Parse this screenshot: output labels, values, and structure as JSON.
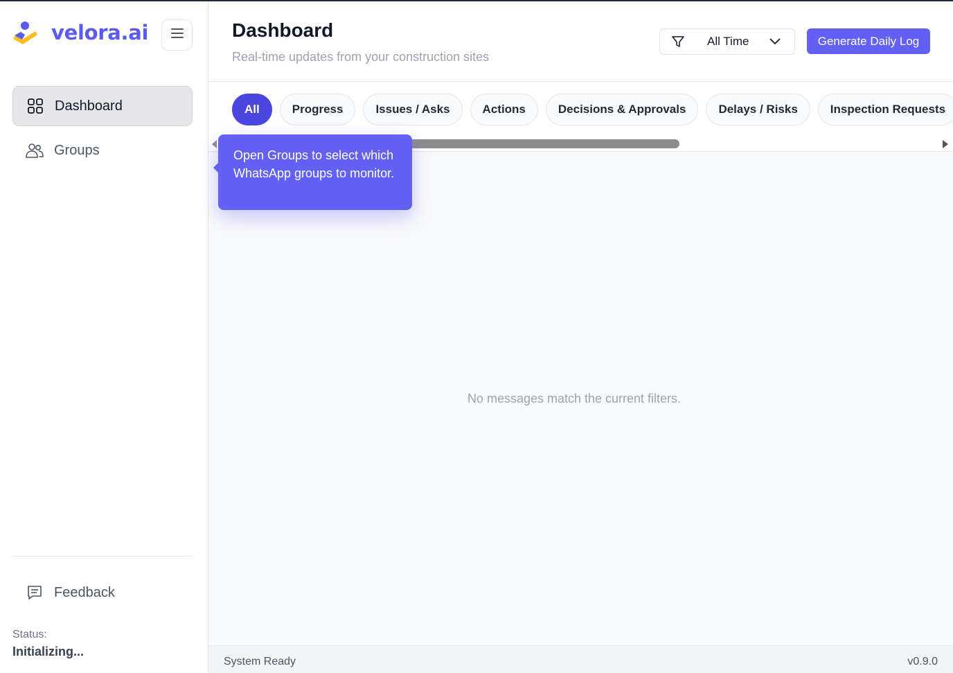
{
  "brand": {
    "name": "velora.ai",
    "logo_icon": "velora-logo-icon"
  },
  "sidebar": {
    "menu_icon": "hamburger-menu-icon",
    "items": [
      {
        "label": "Dashboard",
        "icon": "grid-icon",
        "active": true
      },
      {
        "label": "Groups",
        "icon": "users-icon",
        "active": false
      }
    ],
    "feedback": {
      "label": "Feedback",
      "icon": "message-square-icon"
    },
    "status": {
      "label": "Status:",
      "value": "Initializing..."
    }
  },
  "header": {
    "title": "Dashboard",
    "subtitle": "Real-time updates from your construction sites",
    "time_filter": {
      "icon": "funnel-icon",
      "selected": "All Time",
      "chevron": "chevron-down-icon"
    },
    "primary_button": "Generate Daily Log"
  },
  "tabs": [
    {
      "label": "All",
      "active": true
    },
    {
      "label": "Progress",
      "active": false
    },
    {
      "label": "Issues / Asks",
      "active": false
    },
    {
      "label": "Actions",
      "active": false
    },
    {
      "label": "Decisions & Approvals",
      "active": false
    },
    {
      "label": "Delays / Risks",
      "active": false
    },
    {
      "label": "Inspection Requests",
      "active": false
    }
  ],
  "tooltip": {
    "text": "Open Groups to select which WhatsApp groups to monitor."
  },
  "main": {
    "empty_message": "No messages match the current filters."
  },
  "footer": {
    "left": "System Ready",
    "right": "v0.9.0"
  },
  "colors": {
    "accent": "#6360f4",
    "active_tab": "#4b46e0",
    "logo_yellow": "#fbbf24"
  }
}
